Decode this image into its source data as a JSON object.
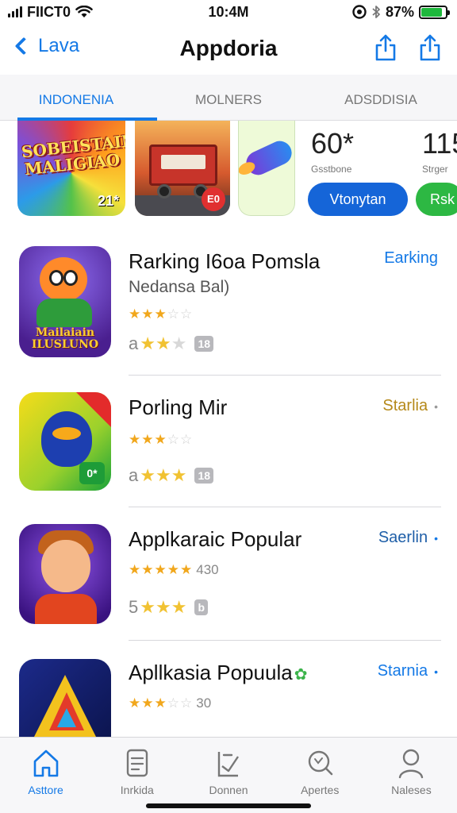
{
  "status": {
    "carrier": "FIICT0",
    "time": "10:4M",
    "battery": "87%",
    "battery_level": 0.87
  },
  "nav": {
    "back_label": "Lava",
    "title": "Appdoria"
  },
  "segments": [
    "INDONENIA",
    "MOLNERS",
    "ADSDDISIA"
  ],
  "featured": {
    "tile1_text": "SOBEISTAIN MALIGIAO",
    "tile1_badge": "21*",
    "tile2_badge": "E0",
    "tile4_num": "60*",
    "tile4_label": "Gsstbone",
    "tile5_num": "115",
    "tile5_label": "Strger",
    "button_blue": "Vtonytan",
    "button_green": "Rsk"
  },
  "apps": [
    {
      "name": "Rarking I6oa Pomsla",
      "subtitle": "Nedansa Bal)",
      "stars_filled": 3,
      "rating_prefix": "a",
      "rating_filled": 2,
      "chip": "18",
      "action": "Earking",
      "icon_text": "Mailaiain ILUSLUNO"
    },
    {
      "name": "Porling Mir",
      "stars_filled": 3,
      "rating_prefix": "a",
      "rating_filled": 3,
      "chip": "18",
      "action": "Starlia",
      "icon_badge": "0*"
    },
    {
      "name": "Applkaraic Popular",
      "stars_filled": 5,
      "stars_count": "430",
      "rating_prefix": "5",
      "rating_filled": 3,
      "chip": "b",
      "action": "Saerlin"
    },
    {
      "name": "Apllkasia Popuula",
      "stars_filled": 3,
      "stars_count": "30",
      "action": "Starnia"
    }
  ],
  "tabs": [
    "Asttore",
    "Inrkida",
    "Donnen",
    "Apertes",
    "Naleses"
  ]
}
